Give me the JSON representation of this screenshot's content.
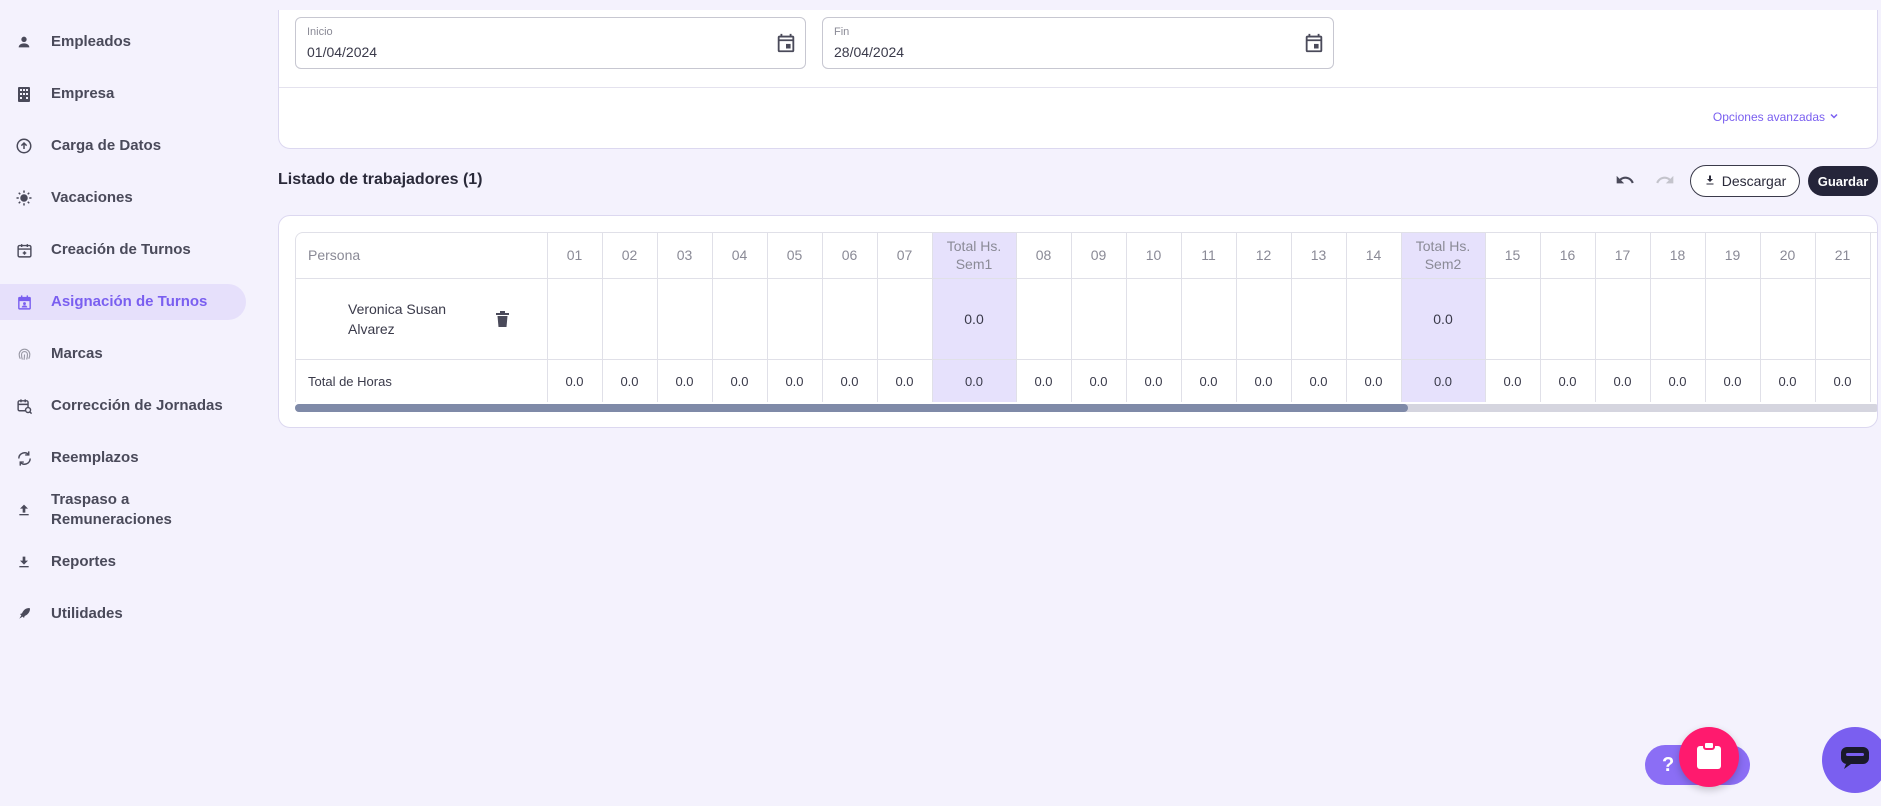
{
  "sidebar": {
    "items": [
      {
        "label": "Empleados",
        "icon": "person-icon"
      },
      {
        "label": "Empresa",
        "icon": "building-icon"
      },
      {
        "label": "Carga de Datos",
        "icon": "upload-circle-icon"
      },
      {
        "label": "Vacaciones",
        "icon": "sun-icon"
      },
      {
        "label": "Creación de Turnos",
        "icon": "calendar-add-icon"
      },
      {
        "label": "Asignación de Turnos",
        "icon": "calendar-person-icon",
        "active": true
      },
      {
        "label": "Marcas",
        "icon": "fingerprint-icon"
      },
      {
        "label": "Corrección de Jornadas",
        "icon": "calendar-search-icon"
      },
      {
        "label": "Reemplazos",
        "icon": "sync-icon"
      },
      {
        "label": "Traspaso a Remuneraciones",
        "icon": "upload-icon"
      },
      {
        "label": "Reportes",
        "icon": "download-icon"
      },
      {
        "label": "Utilidades",
        "icon": "rocket-icon"
      }
    ]
  },
  "filters": {
    "start": {
      "label": "Inicio",
      "value": "01/04/2024"
    },
    "end": {
      "label": "Fin",
      "value": "28/04/2024"
    },
    "advanced_label": "Opciones avanzadas"
  },
  "listing": {
    "title": "Listado de trabajadores (1)",
    "download_label": "Descargar",
    "save_label": "Guardar"
  },
  "table": {
    "persona_header": "Persona",
    "columns": [
      {
        "label": "01"
      },
      {
        "label": "02"
      },
      {
        "label": "03"
      },
      {
        "label": "04"
      },
      {
        "label": "05"
      },
      {
        "label": "06"
      },
      {
        "label": "07"
      },
      {
        "label": "Total Hs. Sem1",
        "week": true
      },
      {
        "label": "08"
      },
      {
        "label": "09"
      },
      {
        "label": "10"
      },
      {
        "label": "11"
      },
      {
        "label": "12"
      },
      {
        "label": "13"
      },
      {
        "label": "14"
      },
      {
        "label": "Total Hs. Sem2",
        "week": true
      },
      {
        "label": "15"
      },
      {
        "label": "16"
      },
      {
        "label": "17"
      },
      {
        "label": "18"
      },
      {
        "label": "19"
      },
      {
        "label": "20"
      },
      {
        "label": "21"
      }
    ],
    "person": {
      "name": "Veronica Susan Alvarez",
      "cells": [
        "",
        "",
        "",
        "",
        "",
        "",
        "",
        "0.0",
        "",
        "",
        "",
        "",
        "",
        "",
        "",
        "0.0",
        "",
        "",
        "",
        "",
        "",
        "",
        ""
      ]
    },
    "totals": {
      "label": "Total de Horas",
      "cells": [
        "0.0",
        "0.0",
        "0.0",
        "0.0",
        "0.0",
        "0.0",
        "0.0",
        "0.0",
        "0.0",
        "0.0",
        "0.0",
        "0.0",
        "0.0",
        "0.0",
        "0.0",
        "0.0",
        "0.0",
        "0.0",
        "0.0",
        "0.0",
        "0.0",
        "0.0",
        "0.0"
      ]
    }
  },
  "help": {
    "label": "?"
  },
  "colors": {
    "accent": "#7a5ff0",
    "week_bg": "#e6e1fc",
    "pink": "#ff1a6e",
    "dark": "#25253a"
  }
}
